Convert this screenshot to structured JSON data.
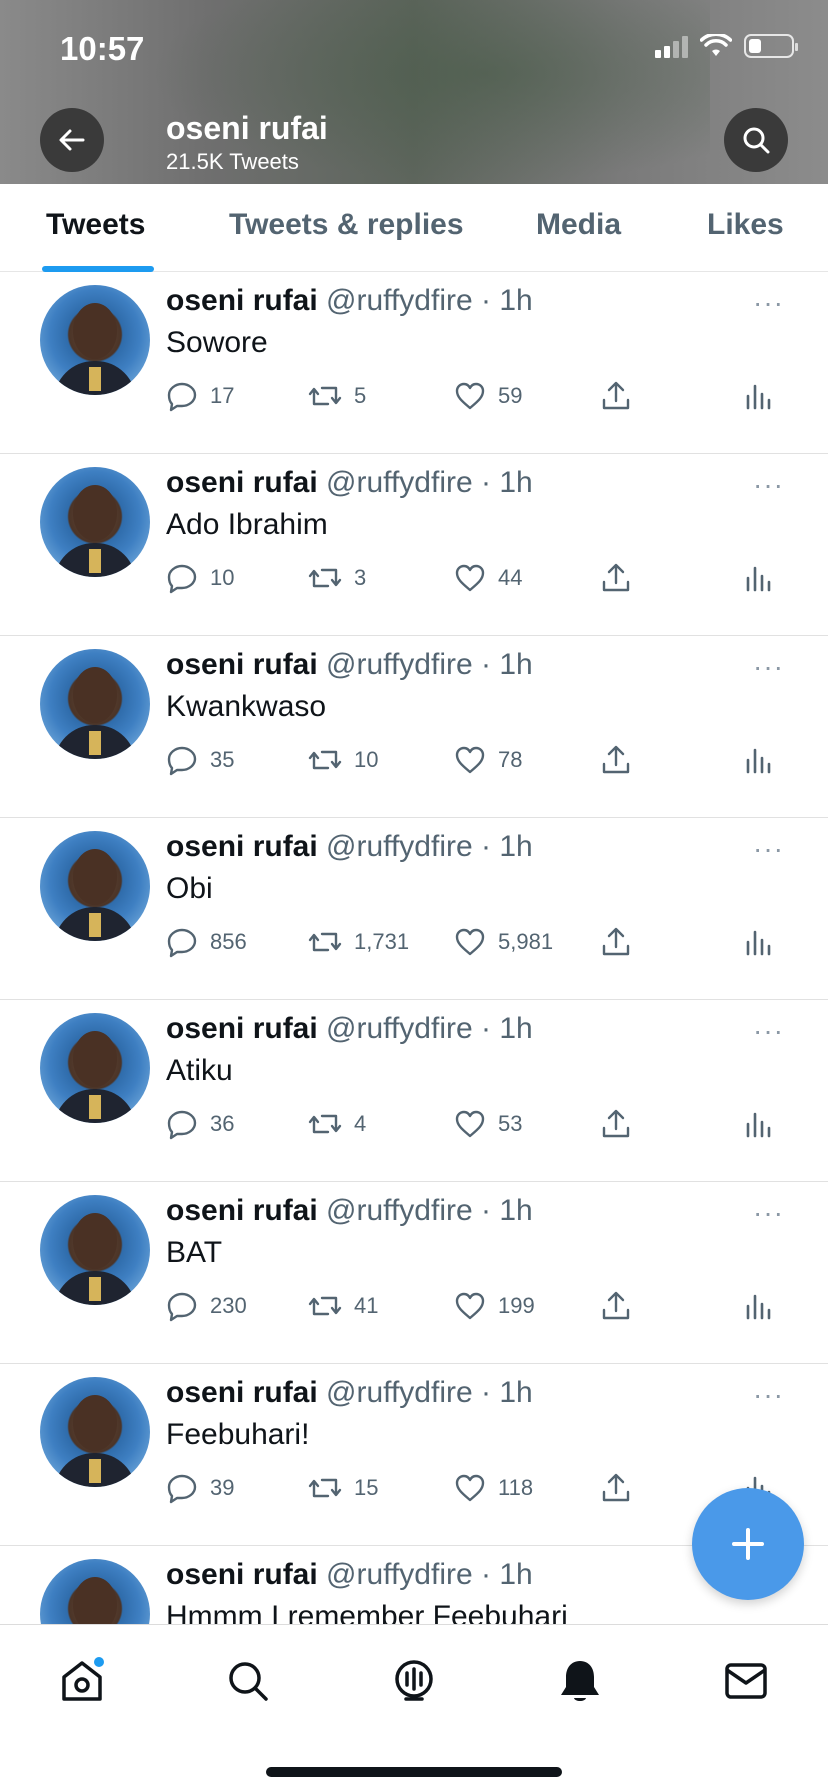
{
  "status_bar": {
    "time": "10:57"
  },
  "header": {
    "name": "oseni rufai",
    "tweet_count": "21.5K Tweets",
    "back_icon": "arrow-left-icon",
    "search_icon": "search-icon"
  },
  "tabs": [
    {
      "label": "Tweets",
      "active": true
    },
    {
      "label": "Tweets & replies",
      "active": false
    },
    {
      "label": "Media",
      "active": false
    },
    {
      "label": "Likes",
      "active": false
    }
  ],
  "tweets": [
    {
      "name": "oseni rufai",
      "handle": "@ruffydfire",
      "time": "· 1h",
      "text": "Sowore",
      "replies": "17",
      "retweets": "5",
      "likes": "59"
    },
    {
      "name": "oseni rufai",
      "handle": "@ruffydfire",
      "time": "· 1h",
      "text": "Ado Ibrahim",
      "replies": "10",
      "retweets": "3",
      "likes": "44"
    },
    {
      "name": "oseni rufai",
      "handle": "@ruffydfire",
      "time": "· 1h",
      "text": "Kwankwaso",
      "replies": "35",
      "retweets": "10",
      "likes": "78"
    },
    {
      "name": "oseni rufai",
      "handle": "@ruffydfire",
      "time": "· 1h",
      "text": "Obi",
      "replies": "856",
      "retweets": "1,731",
      "likes": "5,981"
    },
    {
      "name": "oseni rufai",
      "handle": "@ruffydfire",
      "time": "· 1h",
      "text": "Atiku",
      "replies": "36",
      "retweets": "4",
      "likes": "53"
    },
    {
      "name": "oseni rufai",
      "handle": "@ruffydfire",
      "time": "· 1h",
      "text": "BAT",
      "replies": "230",
      "retweets": "41",
      "likes": "199"
    },
    {
      "name": "oseni rufai",
      "handle": "@ruffydfire",
      "time": "· 1h",
      "text": "Feebuhari!",
      "replies": "39",
      "retweets": "15",
      "likes": "118"
    },
    {
      "name": "oseni rufai",
      "handle": "@ruffydfire",
      "time": "· 1h",
      "text": "Hmmm I remember Feebuhari",
      "replies": "",
      "retweets": "",
      "likes": ""
    }
  ],
  "more_glyph": "···",
  "colors": {
    "accent": "#1d9bf0",
    "fab": "#4a99e9",
    "secondary_text": "#536471"
  },
  "bottom_nav": [
    "home-icon",
    "search-icon",
    "spaces-icon",
    "notifications-icon",
    "messages-icon"
  ]
}
